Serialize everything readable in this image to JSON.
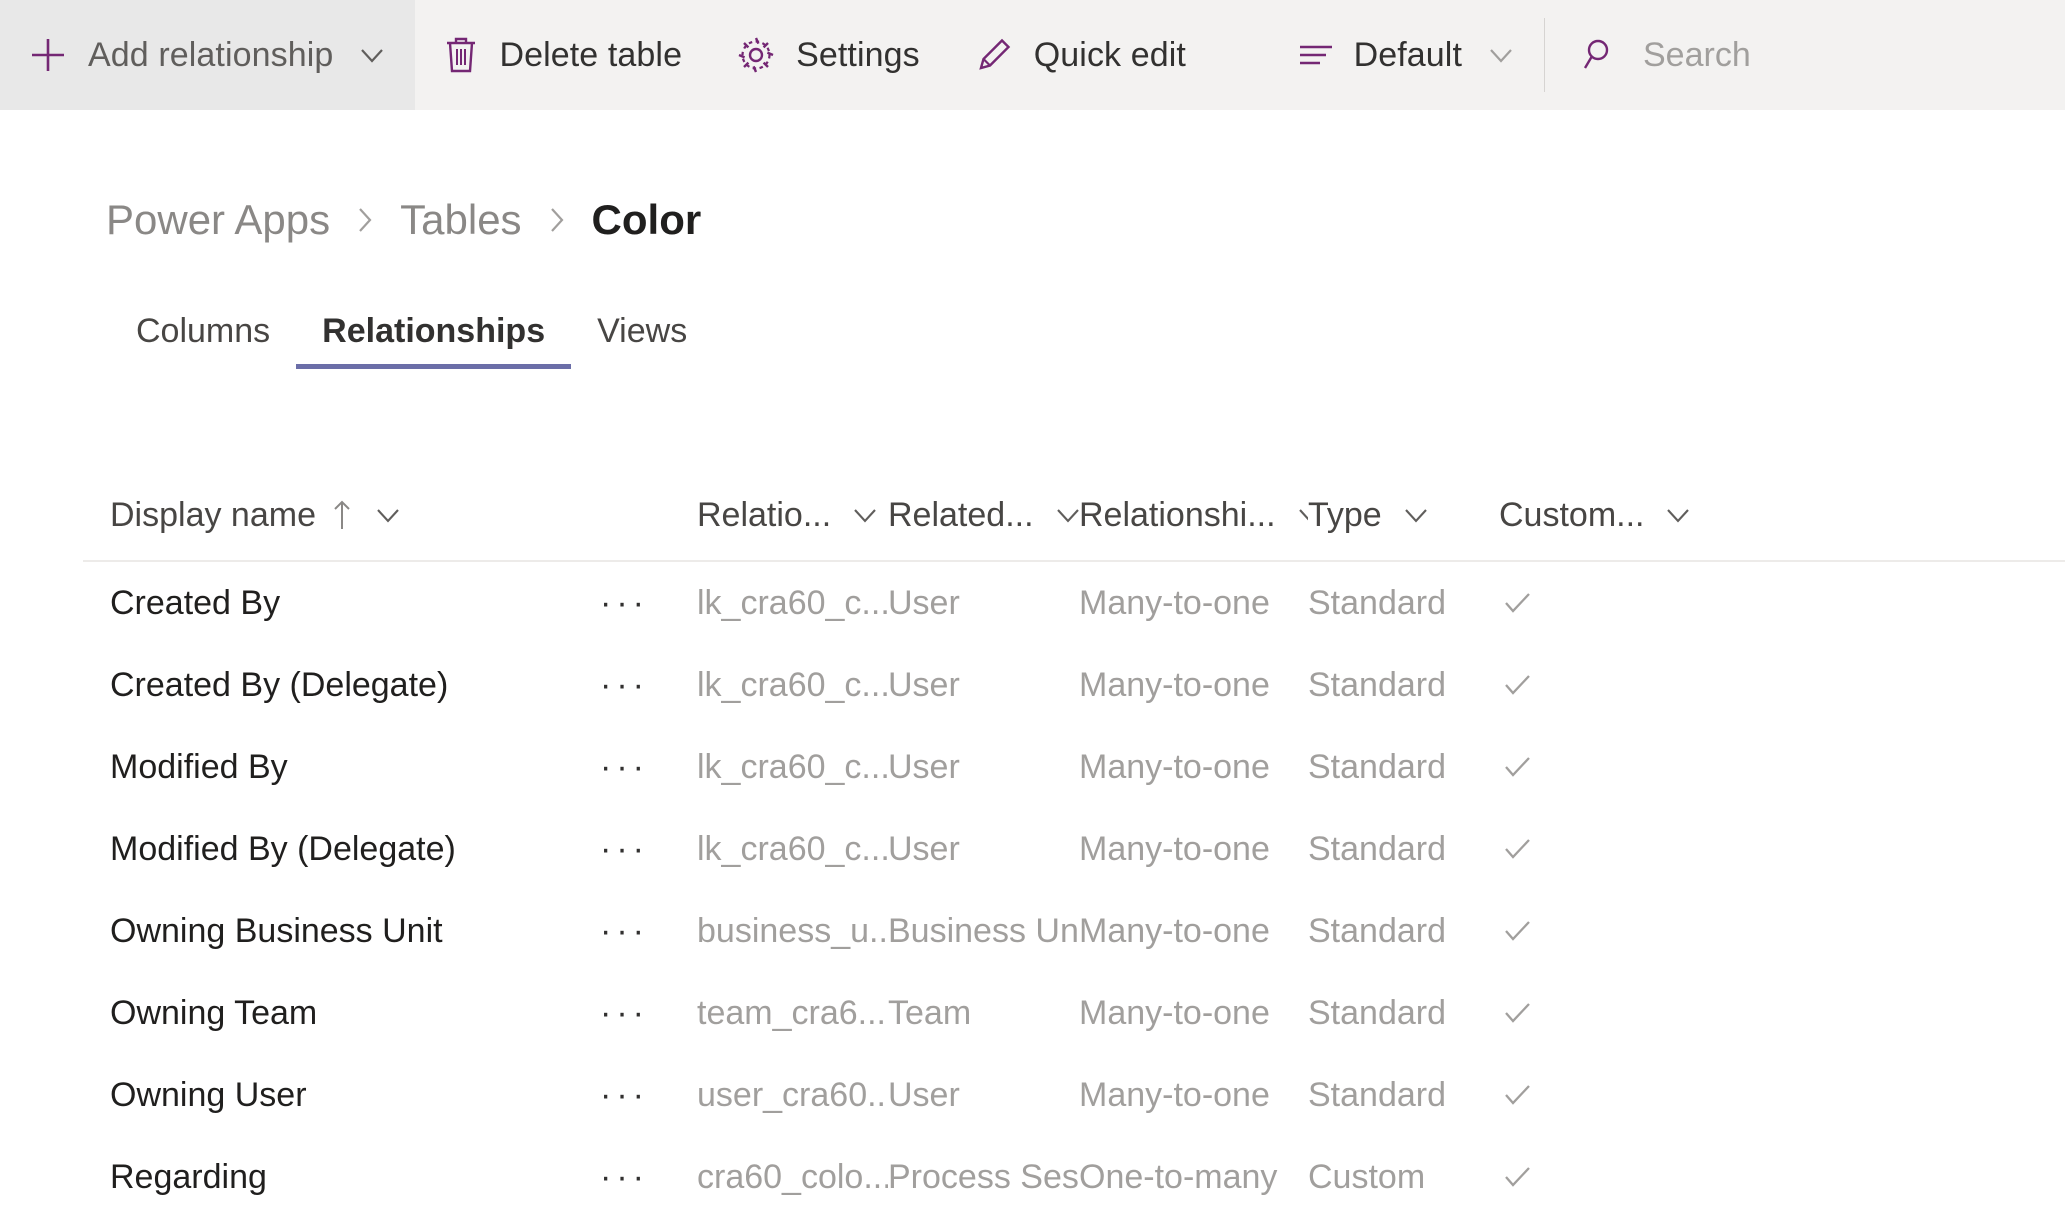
{
  "commandbar": {
    "items": [
      {
        "label": "Add relationship",
        "icon": "plus-icon",
        "has_chevron": true,
        "highlighted": true
      },
      {
        "label": "Delete table",
        "icon": "trash-icon",
        "has_chevron": false,
        "highlighted": false
      },
      {
        "label": "Settings",
        "icon": "gear-icon",
        "has_chevron": false,
        "highlighted": false
      },
      {
        "label": "Quick edit",
        "icon": "pencil-icon",
        "has_chevron": false,
        "highlighted": false
      }
    ],
    "view_selector": {
      "label": "Default",
      "icon": "view-list-icon",
      "has_chevron": true
    },
    "search": {
      "placeholder": "Search",
      "value": "",
      "icon": "search-icon"
    }
  },
  "breadcrumb": {
    "items": [
      "Power Apps",
      "Tables"
    ],
    "current": "Color",
    "separator": "chevron-right-icon"
  },
  "tabs": [
    {
      "label": "Columns",
      "active": false
    },
    {
      "label": "Relationships",
      "active": true
    },
    {
      "label": "Views",
      "active": false
    }
  ],
  "accent_color": "#742774",
  "tab_underline_color": "#6b6ea8",
  "table": {
    "columns": [
      {
        "label": "Display name",
        "sorted": "ascending",
        "sort_icon": "arrow-up-icon",
        "has_menu": true
      },
      {
        "label": "Relatio...",
        "has_menu": true
      },
      {
        "label": "Related...",
        "has_menu": true
      },
      {
        "label": "Relationshi...",
        "has_menu": true
      },
      {
        "label": "Type",
        "has_menu": true
      },
      {
        "label": "Custom...",
        "has_menu": true
      }
    ],
    "rows": [
      {
        "display_name": "Created By",
        "relationship_name": "lk_cra60_c...",
        "related_table": "User",
        "relationship_type": "Many-to-one",
        "type": "Standard",
        "custom": "checkmark-icon"
      },
      {
        "display_name": "Created By (Delegate)",
        "relationship_name": "lk_cra60_c...",
        "related_table": "User",
        "relationship_type": "Many-to-one",
        "type": "Standard",
        "custom": "checkmark-icon"
      },
      {
        "display_name": "Modified By",
        "relationship_name": "lk_cra60_c...",
        "related_table": "User",
        "relationship_type": "Many-to-one",
        "type": "Standard",
        "custom": "checkmark-icon"
      },
      {
        "display_name": "Modified By (Delegate)",
        "relationship_name": "lk_cra60_c...",
        "related_table": "User",
        "relationship_type": "Many-to-one",
        "type": "Standard",
        "custom": "checkmark-icon"
      },
      {
        "display_name": "Owning Business Unit",
        "relationship_name": "business_u...",
        "related_table": "Business Unit",
        "relationship_type": "Many-to-one",
        "type": "Standard",
        "custom": "checkmark-icon"
      },
      {
        "display_name": "Owning Team",
        "relationship_name": "team_cra6...",
        "related_table": "Team",
        "relationship_type": "Many-to-one",
        "type": "Standard",
        "custom": "checkmark-icon"
      },
      {
        "display_name": "Owning User",
        "relationship_name": "user_cra60...",
        "related_table": "User",
        "relationship_type": "Many-to-one",
        "type": "Standard",
        "custom": "checkmark-icon"
      },
      {
        "display_name": "Regarding",
        "relationship_name": "cra60_colo...",
        "related_table": "Process Sessi",
        "relationship_type": "One-to-many",
        "type": "Custom",
        "custom": "checkmark-icon"
      }
    ],
    "row_overflow_label": "···"
  }
}
